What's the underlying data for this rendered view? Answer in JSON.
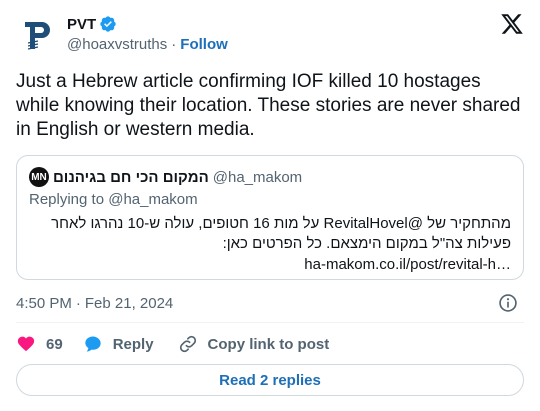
{
  "author": {
    "name": "PVT",
    "handle": "@hoaxvstruths",
    "follow_label": "Follow"
  },
  "tweet": {
    "text": "Just a Hebrew article confirming IOF killed 10 hostages while knowing their location. These stories are never shared in English or western media.",
    "time": "4:50 PM",
    "date": "Feb 21, 2024"
  },
  "quote": {
    "avatar_text": "MN",
    "name": "המקום הכי חם בגיהנום",
    "handle": "@ha_makom",
    "replying_prefix": "Replying to",
    "replying_handle": "@ha_makom",
    "body": "מהתחקיר של @RevitalHovel על מות 16 חטופים, עולה ש-10 נהרגו לאחר פעילות צה\"ל במקום הימצאם. כל הפרטים כאן:",
    "link": "ha-makom.co.il/post/revital-h…"
  },
  "actions": {
    "likes_count": "69",
    "reply_label": "Reply",
    "copy_label": "Copy link to post"
  },
  "footer": {
    "read_replies_label": "Read 2 replies"
  },
  "colors": {
    "accent": "#1d6fb8",
    "verified": "#1d9bf0",
    "heart": "#f91880",
    "secondary_text": "#536471",
    "border": "#cfd9de"
  },
  "icons": [
    "avatar-logo-icon",
    "verified-badge-icon",
    "x-logo-icon",
    "info-icon",
    "heart-icon",
    "reply-bubble-icon",
    "link-icon"
  ]
}
